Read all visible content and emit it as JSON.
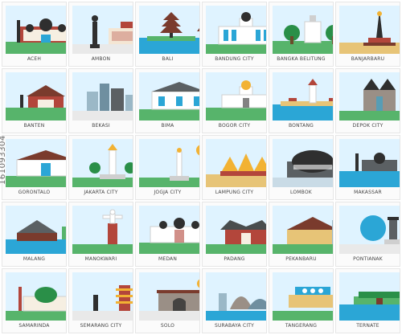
{
  "stock_id": "161093304",
  "palette": {
    "sky": "#dff3ff",
    "grass": "#57b46b",
    "water": "#2ba6d6",
    "dark": "#2f2f2f",
    "brick": "#b3463b",
    "sand": "#e7c477",
    "roof": "#7a3b2d",
    "accent": "#f2b233"
  },
  "tiles": [
    {
      "label": "ACEH",
      "icon": "mosque-domes"
    },
    {
      "label": "AMBON",
      "icon": "statue-and-building"
    },
    {
      "label": "BALI",
      "icon": "pagoda-temple-water"
    },
    {
      "label": "BANDUNG CITY",
      "icon": "colonial-building"
    },
    {
      "label": "BANGKA BELITUNG",
      "icon": "monument-trees"
    },
    {
      "label": "BANJARBARU",
      "icon": "obelisk-monument"
    },
    {
      "label": "BANTEN",
      "icon": "temple-gate"
    },
    {
      "label": "BEKASI",
      "icon": "skyscraper-cluster"
    },
    {
      "label": "BIMA",
      "icon": "palace-building"
    },
    {
      "label": "BOGOR CITY",
      "icon": "palace-with-dome"
    },
    {
      "label": "BONTANG",
      "icon": "coastal-monument"
    },
    {
      "label": "DEPOK CITY",
      "icon": "gothic-cathedral"
    },
    {
      "label": "GORONTALO",
      "icon": "town-hall"
    },
    {
      "label": "JAKARTA CITY",
      "icon": "national-monument"
    },
    {
      "label": "JOGJA CITY",
      "icon": "tugu-monument-sun"
    },
    {
      "label": "LAMPUNG CITY",
      "icon": "crown-monument"
    },
    {
      "label": "LOMBOK",
      "icon": "dome-building"
    },
    {
      "label": "MAKASSAR",
      "icon": "mosque-water"
    },
    {
      "label": "MALANG",
      "icon": "traditional-house-lake"
    },
    {
      "label": "MANOKWARI",
      "icon": "jesus-statue"
    },
    {
      "label": "MEDAN",
      "icon": "istana-maimun"
    },
    {
      "label": "PADANG",
      "icon": "minangkabau-house"
    },
    {
      "label": "PEKANBARU",
      "icon": "riau-roof-building"
    },
    {
      "label": "PONTIANAK",
      "icon": "equator-monument"
    },
    {
      "label": "SAMARINDA",
      "icon": "mosque-green-dome"
    },
    {
      "label": "SEMARANG CITY",
      "icon": "pagoda-tower"
    },
    {
      "label": "SOLO",
      "icon": "gate-arch"
    },
    {
      "label": "SURABAYA CITY",
      "icon": "shark-crocodile-statue"
    },
    {
      "label": "TANGERANG",
      "icon": "city-signboard"
    },
    {
      "label": "TERNATE",
      "icon": "kota-ternate-sign"
    }
  ]
}
